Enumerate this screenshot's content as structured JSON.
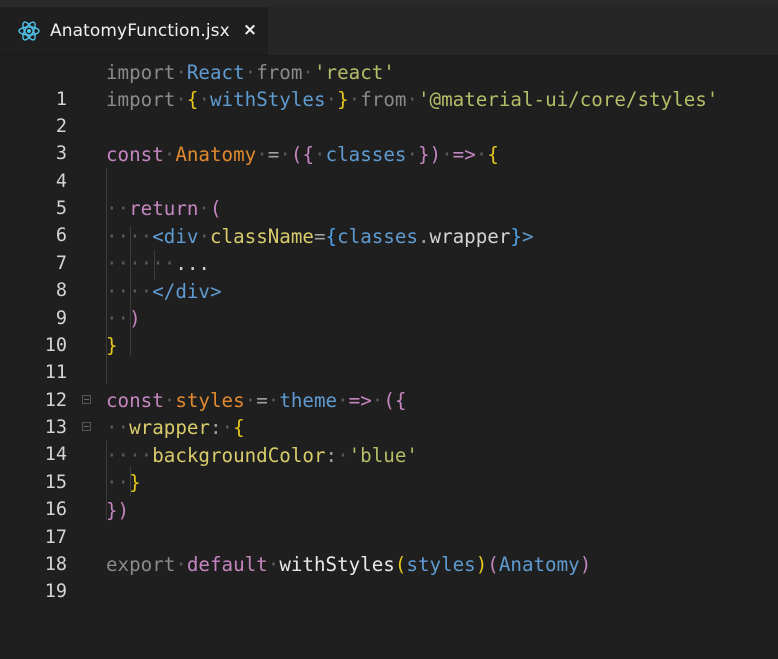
{
  "tab": {
    "title": "AnatomyFunction.jsx",
    "close_glyph": "×",
    "icon": "react-icon"
  },
  "lines": [
    {
      "n": "1"
    },
    {
      "n": "2"
    },
    {
      "n": "3"
    },
    {
      "n": "4"
    },
    {
      "n": "5"
    },
    {
      "n": "6"
    },
    {
      "n": "7"
    },
    {
      "n": "8"
    },
    {
      "n": "9"
    },
    {
      "n": "10"
    },
    {
      "n": "11"
    },
    {
      "n": "12"
    },
    {
      "n": "13"
    },
    {
      "n": "14"
    },
    {
      "n": "15"
    },
    {
      "n": "16"
    },
    {
      "n": "17"
    },
    {
      "n": "18"
    },
    {
      "n": "19"
    }
  ],
  "code": {
    "l1": [
      "import",
      "React",
      "from",
      "'react'"
    ],
    "l2": [
      "import",
      "{",
      "withStyles",
      "}",
      "from",
      "'@material-ui/core/styles'"
    ],
    "l4": [
      "const",
      "Anatomy",
      "=",
      "({",
      "classes",
      "})",
      "=>",
      "{"
    ],
    "l6": [
      "return",
      "("
    ],
    "l7": [
      "<div",
      "className",
      "=",
      "{",
      "classes",
      ".",
      "wrapper",
      "}",
      ">"
    ],
    "l8": [
      "..."
    ],
    "l9": [
      "</div>"
    ],
    "l10": [
      ")"
    ],
    "l11": [
      "}"
    ],
    "l13": [
      "const",
      "styles",
      "=",
      "theme",
      "=>",
      "({"
    ],
    "l14": [
      "wrapper",
      ":",
      "{"
    ],
    "l15": [
      "backgroundColor",
      ":",
      "'blue'"
    ],
    "l16": [
      "}"
    ],
    "l17": [
      "})"
    ],
    "l19": [
      "export",
      "default",
      "withStyles",
      "(",
      "styles",
      ")",
      "(",
      "Anatomy",
      ")"
    ]
  },
  "colors": {
    "background": "#1f1f1f",
    "keyword": "#8a8a8a",
    "identifier": "#5f9bd1",
    "string": "#b5bd68",
    "bracket_gold": "#e5c81a",
    "bracket_pink": "#c586c0",
    "component": "#e0892f"
  }
}
